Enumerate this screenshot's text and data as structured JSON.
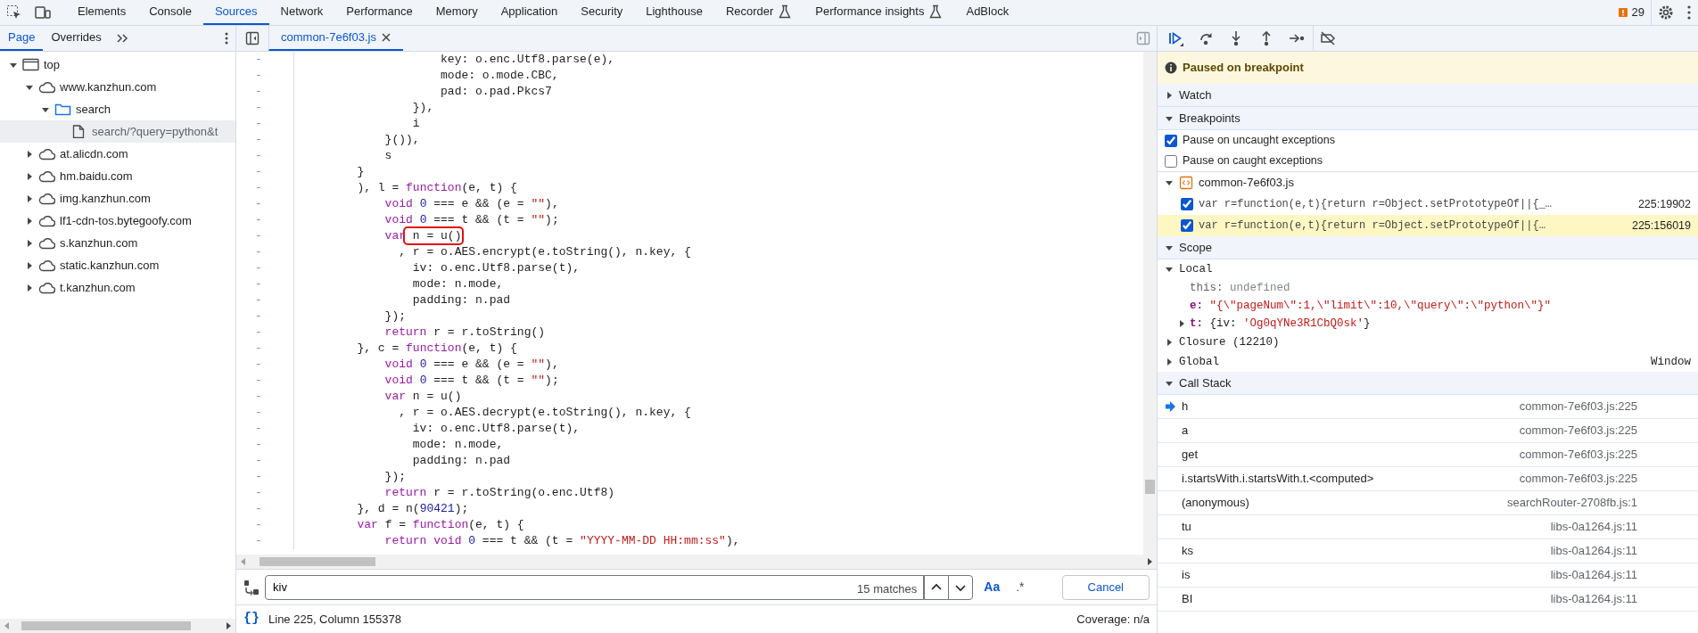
{
  "main_tabs": [
    {
      "label": "Elements",
      "selected": false,
      "experimental": false
    },
    {
      "label": "Console",
      "selected": false,
      "experimental": false
    },
    {
      "label": "Sources",
      "selected": true,
      "experimental": false
    },
    {
      "label": "Network",
      "selected": false,
      "experimental": false
    },
    {
      "label": "Performance",
      "selected": false,
      "experimental": false
    },
    {
      "label": "Memory",
      "selected": false,
      "experimental": false
    },
    {
      "label": "Application",
      "selected": false,
      "experimental": false
    },
    {
      "label": "Security",
      "selected": false,
      "experimental": false
    },
    {
      "label": "Lighthouse",
      "selected": false,
      "experimental": false
    },
    {
      "label": "Recorder",
      "selected": false,
      "experimental": true
    },
    {
      "label": "Performance insights",
      "selected": false,
      "experimental": true
    },
    {
      "label": "AdBlock",
      "selected": false,
      "experimental": false
    }
  ],
  "issues_count": "29",
  "navigator": {
    "tabs": [
      {
        "label": "Page",
        "selected": true
      },
      {
        "label": "Overrides",
        "selected": false
      }
    ],
    "tree": [
      {
        "label": "top",
        "kind": "frame",
        "expanded": true,
        "selected": false,
        "children": [
          {
            "label": "www.kanzhun.com",
            "kind": "domain",
            "expanded": true,
            "selected": false,
            "children": [
              {
                "label": "search",
                "kind": "folder",
                "expanded": true,
                "selected": false,
                "children": [
                  {
                    "label": "search/?query=python&t",
                    "kind": "file",
                    "selected": true
                  }
                ]
              }
            ]
          },
          {
            "label": "at.alicdn.com",
            "kind": "domain",
            "expanded": false,
            "selected": false
          },
          {
            "label": "hm.baidu.com",
            "kind": "domain",
            "expanded": false,
            "selected": false
          },
          {
            "label": "img.kanzhun.com",
            "kind": "domain",
            "expanded": false,
            "selected": false
          },
          {
            "label": "lf1-cdn-tos.bytegoofy.com",
            "kind": "domain",
            "expanded": false,
            "selected": false
          },
          {
            "label": "s.kanzhun.com",
            "kind": "domain",
            "expanded": false,
            "selected": false
          },
          {
            "label": "static.kanzhun.com",
            "kind": "domain",
            "expanded": false,
            "selected": false
          },
          {
            "label": "t.kanzhun.com",
            "kind": "domain",
            "expanded": false,
            "selected": false
          }
        ]
      }
    ]
  },
  "editor": {
    "tabs": [
      {
        "label": "common-7e6f03.js",
        "selected": true
      }
    ],
    "lines": [
      {
        "gutter": "-",
        "tokens": [
          {
            "kind": "plain",
            "text": "                    key: o.enc.Utf8.parse(e),"
          }
        ]
      },
      {
        "gutter": "-",
        "tokens": [
          {
            "kind": "plain",
            "text": "                    mode: o.mode.CBC,"
          }
        ]
      },
      {
        "gutter": "-",
        "tokens": [
          {
            "kind": "plain",
            "text": "                    pad: o.pad.Pkcs7"
          }
        ]
      },
      {
        "gutter": "-",
        "tokens": [
          {
            "kind": "plain",
            "text": "                }),"
          }
        ]
      },
      {
        "gutter": "-",
        "tokens": [
          {
            "kind": "plain",
            "text": "                i"
          }
        ]
      },
      {
        "gutter": "-",
        "tokens": [
          {
            "kind": "plain",
            "text": "            }()),"
          }
        ]
      },
      {
        "gutter": "-",
        "tokens": [
          {
            "kind": "plain",
            "text": "            s"
          }
        ]
      },
      {
        "gutter": "-",
        "tokens": [
          {
            "kind": "plain",
            "text": "        }"
          }
        ]
      },
      {
        "gutter": "-",
        "tokens": [
          {
            "kind": "plain",
            "text": "        ), l = "
          },
          {
            "kind": "keyword",
            "text": "function"
          },
          {
            "kind": "plain",
            "text": "(e, t) {"
          }
        ]
      },
      {
        "gutter": "-",
        "tokens": [
          {
            "kind": "keyword",
            "text": "            void"
          },
          {
            "kind": "number",
            "text": " 0"
          },
          {
            "kind": "plain",
            "text": " === e && (e = "
          },
          {
            "kind": "string",
            "text": "\"\""
          },
          {
            "kind": "plain",
            "text": "),"
          }
        ]
      },
      {
        "gutter": "-",
        "tokens": [
          {
            "kind": "keyword",
            "text": "            void"
          },
          {
            "kind": "number",
            "text": " 0"
          },
          {
            "kind": "plain",
            "text": " === t && (t = "
          },
          {
            "kind": "string",
            "text": "\"\""
          },
          {
            "kind": "plain",
            "text": ");"
          }
        ]
      },
      {
        "gutter": "-",
        "tokens": [
          {
            "kind": "keyword",
            "text": "            var"
          },
          {
            "kind": "plain",
            "text": " n = u()",
            "boxed": true
          }
        ]
      },
      {
        "gutter": "-",
        "tokens": [
          {
            "kind": "plain",
            "text": "              , r = o.AES.encrypt(e.toString(), n.key, {"
          }
        ]
      },
      {
        "gutter": "-",
        "tokens": [
          {
            "kind": "plain",
            "text": "                iv: o.enc.Utf8.parse(t),"
          }
        ]
      },
      {
        "gutter": "-",
        "tokens": [
          {
            "kind": "plain",
            "text": "                mode: n.mode,"
          }
        ]
      },
      {
        "gutter": "-",
        "tokens": [
          {
            "kind": "plain",
            "text": "                padding: n.pad"
          }
        ]
      },
      {
        "gutter": "-",
        "tokens": [
          {
            "kind": "plain",
            "text": "            });"
          }
        ]
      },
      {
        "gutter": "-",
        "tokens": [
          {
            "kind": "keyword",
            "text": "            return"
          },
          {
            "kind": "plain",
            "text": " r = r.toString()"
          }
        ]
      },
      {
        "gutter": "-",
        "tokens": [
          {
            "kind": "plain",
            "text": "        }, c = "
          },
          {
            "kind": "keyword",
            "text": "function"
          },
          {
            "kind": "plain",
            "text": "(e, t) {"
          }
        ]
      },
      {
        "gutter": "-",
        "tokens": [
          {
            "kind": "keyword",
            "text": "            void"
          },
          {
            "kind": "number",
            "text": " 0"
          },
          {
            "kind": "plain",
            "text": " === e && (e = "
          },
          {
            "kind": "string",
            "text": "\"\""
          },
          {
            "kind": "plain",
            "text": "),"
          }
        ]
      },
      {
        "gutter": "-",
        "tokens": [
          {
            "kind": "keyword",
            "text": "            void"
          },
          {
            "kind": "number",
            "text": " 0"
          },
          {
            "kind": "plain",
            "text": " === t && (t = "
          },
          {
            "kind": "string",
            "text": "\"\""
          },
          {
            "kind": "plain",
            "text": ");"
          }
        ]
      },
      {
        "gutter": "-",
        "tokens": [
          {
            "kind": "keyword",
            "text": "            var"
          },
          {
            "kind": "plain",
            "text": " n = u()"
          }
        ]
      },
      {
        "gutter": "-",
        "tokens": [
          {
            "kind": "plain",
            "text": "              , r = o.AES.decrypt(e.toString(), n.key, {"
          }
        ]
      },
      {
        "gutter": "-",
        "tokens": [
          {
            "kind": "plain",
            "text": "                iv: o.enc.Utf8.parse(t),"
          }
        ]
      },
      {
        "gutter": "-",
        "tokens": [
          {
            "kind": "plain",
            "text": "                mode: n.mode,"
          }
        ]
      },
      {
        "gutter": "-",
        "tokens": [
          {
            "kind": "plain",
            "text": "                padding: n.pad"
          }
        ]
      },
      {
        "gutter": "-",
        "tokens": [
          {
            "kind": "plain",
            "text": "            });"
          }
        ]
      },
      {
        "gutter": "-",
        "tokens": [
          {
            "kind": "keyword",
            "text": "            return"
          },
          {
            "kind": "plain",
            "text": " r = r.toString(o.enc.Utf8)"
          }
        ]
      },
      {
        "gutter": "-",
        "tokens": [
          {
            "kind": "plain",
            "text": "        }, d = n("
          },
          {
            "kind": "number",
            "text": "90421"
          },
          {
            "kind": "plain",
            "text": ");"
          }
        ]
      },
      {
        "gutter": "-",
        "tokens": [
          {
            "kind": "keyword",
            "text": "        var"
          },
          {
            "kind": "plain",
            "text": " f = "
          },
          {
            "kind": "keyword",
            "text": "function"
          },
          {
            "kind": "plain",
            "text": "(e, t) {"
          }
        ]
      },
      {
        "gutter": "-",
        "tokens": [
          {
            "kind": "keyword",
            "text": "            return void"
          },
          {
            "kind": "number",
            "text": " 0"
          },
          {
            "kind": "plain",
            "text": " === t && (t = "
          },
          {
            "kind": "string",
            "text": "\"YYYY-MM-DD HH:mm:ss\""
          },
          {
            "kind": "plain",
            "text": "),"
          }
        ]
      }
    ],
    "search": {
      "value": "kiv",
      "matches": "15 matches",
      "match_case_label": "Aa",
      "match_case": true,
      "regex_label": ".*",
      "regex": false,
      "cancel": "Cancel"
    },
    "status": {
      "pretty_print": "{}",
      "position": "Line 225, Column 155378",
      "coverage": "Coverage: n/a"
    }
  },
  "debugger": {
    "banner": "Paused on breakpoint",
    "sections": [
      {
        "kind": "watch",
        "title": "Watch",
        "expanded": false
      },
      {
        "kind": "breakpoints",
        "title": "Breakpoints",
        "expanded": true,
        "options": [
          {
            "label": "Pause on uncaught exceptions",
            "checked": true
          },
          {
            "label": "Pause on caught exceptions",
            "checked": false
          }
        ],
        "files": [
          {
            "name": "common-7e6f03.js",
            "expanded": true,
            "breakpoints": [
              {
                "code": "var r=function(e,t){return r=Object.setPrototypeOf||{_…",
                "location": "225:19902",
                "checked": true,
                "hit": false
              },
              {
                "code": "var r=function(e,t){return r=Object.setPrototypeOf||{…",
                "location": "225:156019",
                "checked": true,
                "hit": true
              }
            ]
          }
        ]
      },
      {
        "kind": "scope",
        "title": "Scope",
        "expanded": true,
        "scopes": [
          {
            "name": "Local",
            "expanded": true,
            "properties": [
              {
                "name": "this:",
                "dim_name": true,
                "value": [
                  {
                    "kind": "undefined",
                    "text": "undefined"
                  }
                ]
              },
              {
                "name": "e:",
                "dim_name": false,
                "value": [
                  {
                    "kind": "string",
                    "text": "\"{\\\"pageNum\\\":1,\\\"limit\\\":10,\\\"query\\\":\\\"python\\\"}\""
                  }
                ]
              },
              {
                "name": "t:",
                "dim_name": false,
                "expanded": false,
                "value": [
                  {
                    "kind": "plain",
                    "text": "{iv: "
                  },
                  {
                    "kind": "string",
                    "text": "'Og0qYNe3R1CbQ0sk'"
                  },
                  {
                    "kind": "plain",
                    "text": "}"
                  }
                ]
              }
            ]
          },
          {
            "name": "Closure (12210)",
            "expanded": false
          },
          {
            "name": "Global",
            "expanded": false,
            "value": "Window"
          }
        ]
      },
      {
        "kind": "call_stack",
        "title": "Call Stack",
        "expanded": true,
        "frames": [
          {
            "name": "h",
            "location": "common-7e6f03.js:225",
            "selected": true
          },
          {
            "name": "a",
            "location": "common-7e6f03.js:225",
            "selected": false
          },
          {
            "name": "get",
            "location": "common-7e6f03.js:225",
            "selected": false
          },
          {
            "name": "i.startsWith.i.startsWith.t.<computed>",
            "location": "common-7e6f03.js:225",
            "selected": false
          },
          {
            "name": "(anonymous)",
            "location": "searchRouter-2708fb.js:1",
            "selected": false
          },
          {
            "name": "tu",
            "location": "libs-0a1264.js:11",
            "selected": false
          },
          {
            "name": "ks",
            "location": "libs-0a1264.js:11",
            "selected": false
          },
          {
            "name": "is",
            "location": "libs-0a1264.js:11",
            "selected": false
          },
          {
            "name": "BI",
            "location": "libs-0a1264.js:11",
            "selected": false
          }
        ]
      }
    ]
  }
}
